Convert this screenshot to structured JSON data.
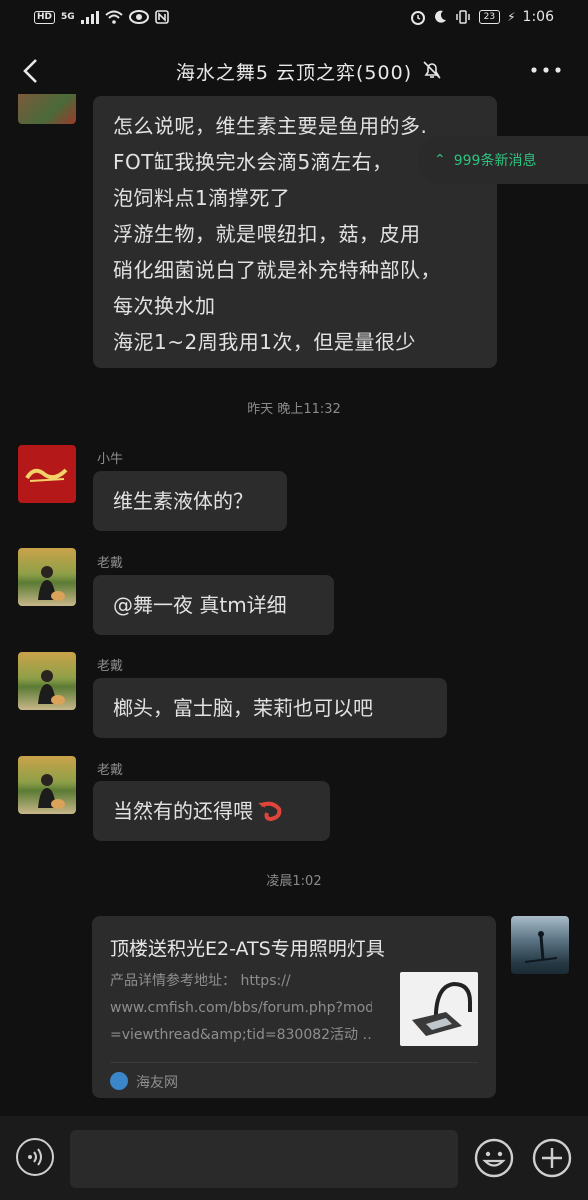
{
  "status_bar": {
    "hd_badge": "HD",
    "network": "5G",
    "battery": "23",
    "time": "1:06"
  },
  "header": {
    "title": "海水之舞5 云顶之弈(500)"
  },
  "new_messages_banner": "999条新消息",
  "messages": [
    {
      "lines": [
        "怎么说呢，维生素主要是鱼用的多.",
        "FOT缸我换完水会滴5滴左右，",
        "泡饲料点1滴撑死了",
        "浮游生物，就是喂纽扣，菇，皮用",
        "硝化细菌说白了就是补充特种部队，",
        "每次换水加",
        "海泥1~2周我用1次，但是量很少"
      ]
    }
  ],
  "timestamp_1": "昨天 晚上11:32",
  "msg_xiaoniu": {
    "sender": "小牛",
    "text": "维生素液体的？"
  },
  "msg_laodai_1": {
    "sender": "老戴",
    "text": "@舞一夜  真tm详细"
  },
  "msg_laodai_2": {
    "sender": "老戴",
    "text": "榔头，富士脑，茉莉也可以吧"
  },
  "msg_laodai_3": {
    "sender": "老戴",
    "text": "当然有的还得喂"
  },
  "timestamp_2": "凌晨1:02",
  "link_card": {
    "title": "顶楼送积光E2-ATS专用照明灯具",
    "desc_line1": "产品详情参考地址： https://",
    "desc_line2": "www.cmfish.com/bbs/forum.php?mod",
    "desc_line3": "=viewthread&amp;tid=830082活动 …",
    "source": "海友网"
  },
  "colors": {
    "background": "#111111",
    "bubble": "#2c2c2c",
    "accent_green": "#2ec27e"
  }
}
